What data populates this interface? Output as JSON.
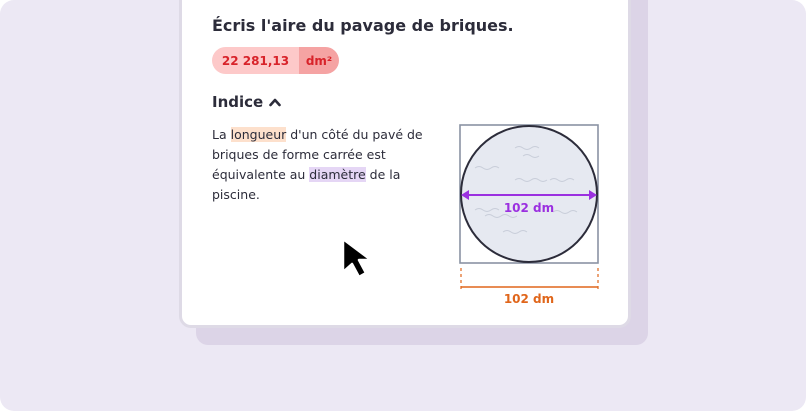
{
  "question": "Écris l'aire du pavage de briques.",
  "answer": {
    "value": "22 281,13",
    "unit": "dm²"
  },
  "hint": {
    "title": "Indice",
    "text_1": "La ",
    "highlight_1": "longueur",
    "text_2": " d'un côté du pavé de briques de forme carrée est équivalente au ",
    "highlight_2": "diamètre",
    "text_3": " de la piscine."
  },
  "figure": {
    "diameter_label": "102 dm",
    "side_label": "102 dm"
  },
  "colors": {
    "answer_bg": "#fdc9c9",
    "answer_text": "#d8232a",
    "diameter": "#9b30e0",
    "side": "#e0661b"
  }
}
